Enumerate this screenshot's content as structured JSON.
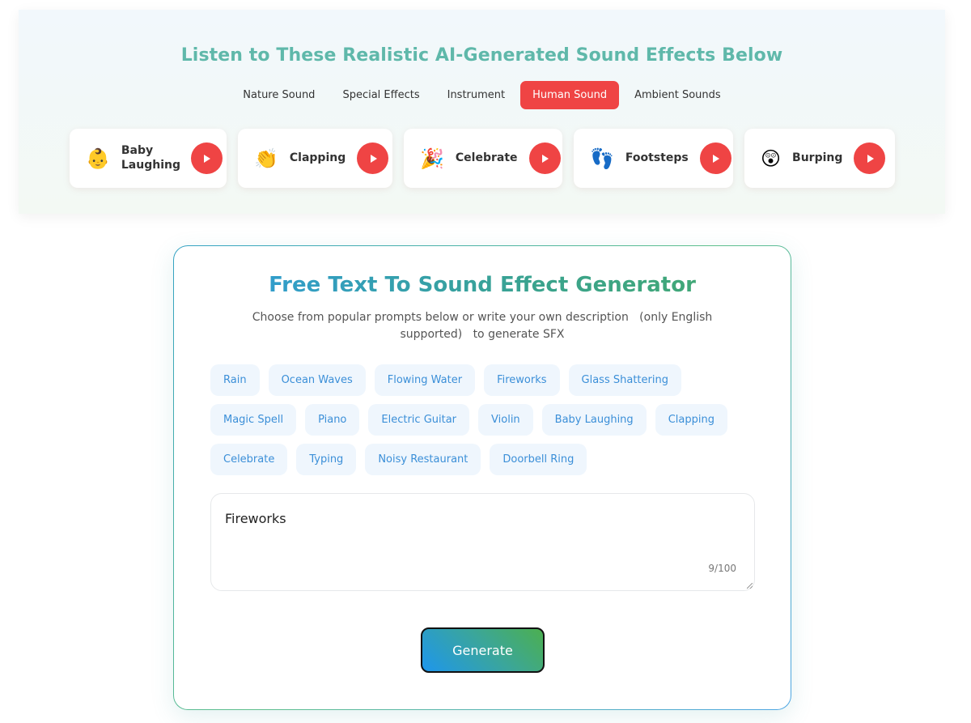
{
  "showcase": {
    "title": "Listen to These Realistic AI-Generated Sound Effects Below",
    "tabs": [
      {
        "label": "Nature Sound",
        "active": false
      },
      {
        "label": "Special Effects",
        "active": false
      },
      {
        "label": "Instrument",
        "active": false
      },
      {
        "label": "Human Sound",
        "active": true
      },
      {
        "label": "Ambient Sounds",
        "active": false
      }
    ],
    "cards": [
      {
        "emoji": "👶",
        "icon": "baby-face-icon",
        "label": "Baby Laughing"
      },
      {
        "emoji": "👏",
        "icon": "clapping-hands-icon",
        "label": "Clapping"
      },
      {
        "emoji": "🎉",
        "icon": "party-popper-icon",
        "label": "Celebrate"
      },
      {
        "emoji": "👣",
        "icon": "footprints-icon",
        "label": "Footsteps"
      },
      {
        "emoji": "😲",
        "icon": "astonished-face-icon",
        "label": "Burping"
      }
    ]
  },
  "generator": {
    "title": "Free Text To Sound Effect Generator",
    "subtitle": "Choose from popular prompts below or write your own description   (only English supported)   to generate SFX",
    "prompts": [
      "Rain",
      "Ocean Waves",
      "Flowing Water",
      "Fireworks",
      "Glass Shattering",
      "Magic Spell",
      "Piano",
      "Electric Guitar",
      "Violin",
      "Baby Laughing",
      "Clapping",
      "Celebrate",
      "Typing",
      "Noisy Restaurant",
      "Doorbell Ring"
    ],
    "input_value": "Fireworks",
    "counter": "9/100",
    "generate_label": "Generate"
  },
  "colors": {
    "accent_red": "#ef4444",
    "chip_text": "#3b8fd8",
    "chip_bg": "#eff6fd",
    "showcase_title": "#5fb8aa"
  }
}
